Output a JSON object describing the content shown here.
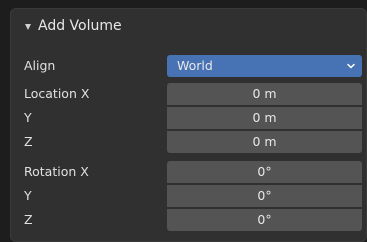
{
  "panel": {
    "title": "Add Volume"
  },
  "align": {
    "label": "Align",
    "value": "World"
  },
  "location": {
    "x_label": "Location X",
    "y_label": "Y",
    "z_label": "Z",
    "x_value": "0 m",
    "y_value": "0 m",
    "z_value": "0 m"
  },
  "rotation": {
    "x_label": "Rotation X",
    "y_label": "Y",
    "z_label": "Z",
    "x_value": "0°",
    "y_value": "0°",
    "z_value": "0°"
  },
  "colors": {
    "accent": "#4772b3",
    "field": "#545454",
    "panel": "#303030"
  }
}
